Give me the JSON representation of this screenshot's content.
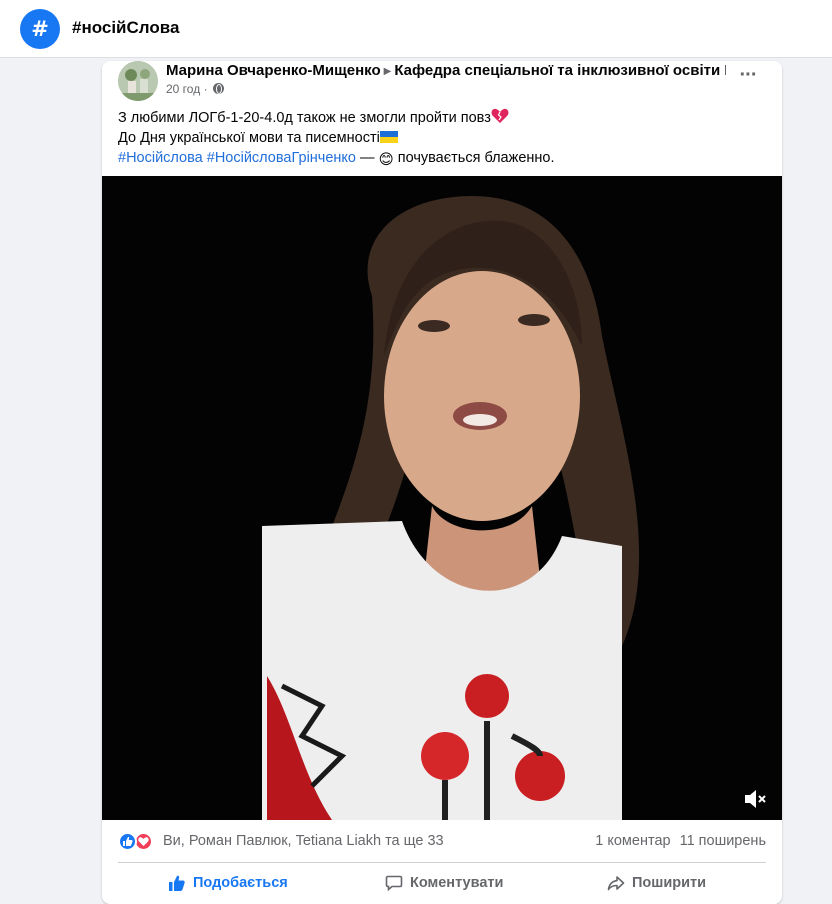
{
  "header": {
    "hash_symbol": "#",
    "title": "#носійСлова"
  },
  "post": {
    "author": "Марина Овчаренко-Мищенко",
    "group": "Кафедра спеціальної та інклюзивної освіти ІЛ",
    "time": "20 год",
    "meta_separator": "·",
    "more_label": "···",
    "text_line1": "З любими ЛОГб-1-20-4.0д також не змогли пройти повз",
    "text_line2": "До Дня української мови та писемності",
    "hashtag1": "#Носійслова",
    "hashtag2": "#НосійсловаГрінченко",
    "text_line3_rest": " — ",
    "text_line3_end": " почувається блаженно.",
    "emoji_heart": "❤",
    "emoji_flag": "flag-ua",
    "emoji_smile": "😊"
  },
  "video": {
    "mute_icon": "speaker-muted-icon"
  },
  "engagement": {
    "reactors": "Ви, Роман Павлюк, Tetiana Liakh та ще 33",
    "comments": "1 коментар",
    "shares": "11 поширень"
  },
  "actions": {
    "like": "Подобається",
    "comment": "Коментувати",
    "share": "Поширити"
  },
  "colors": {
    "accent": "#1877f2",
    "hashtag": "#216fdb",
    "love": "#f33e58",
    "muted_text": "#65676b"
  }
}
